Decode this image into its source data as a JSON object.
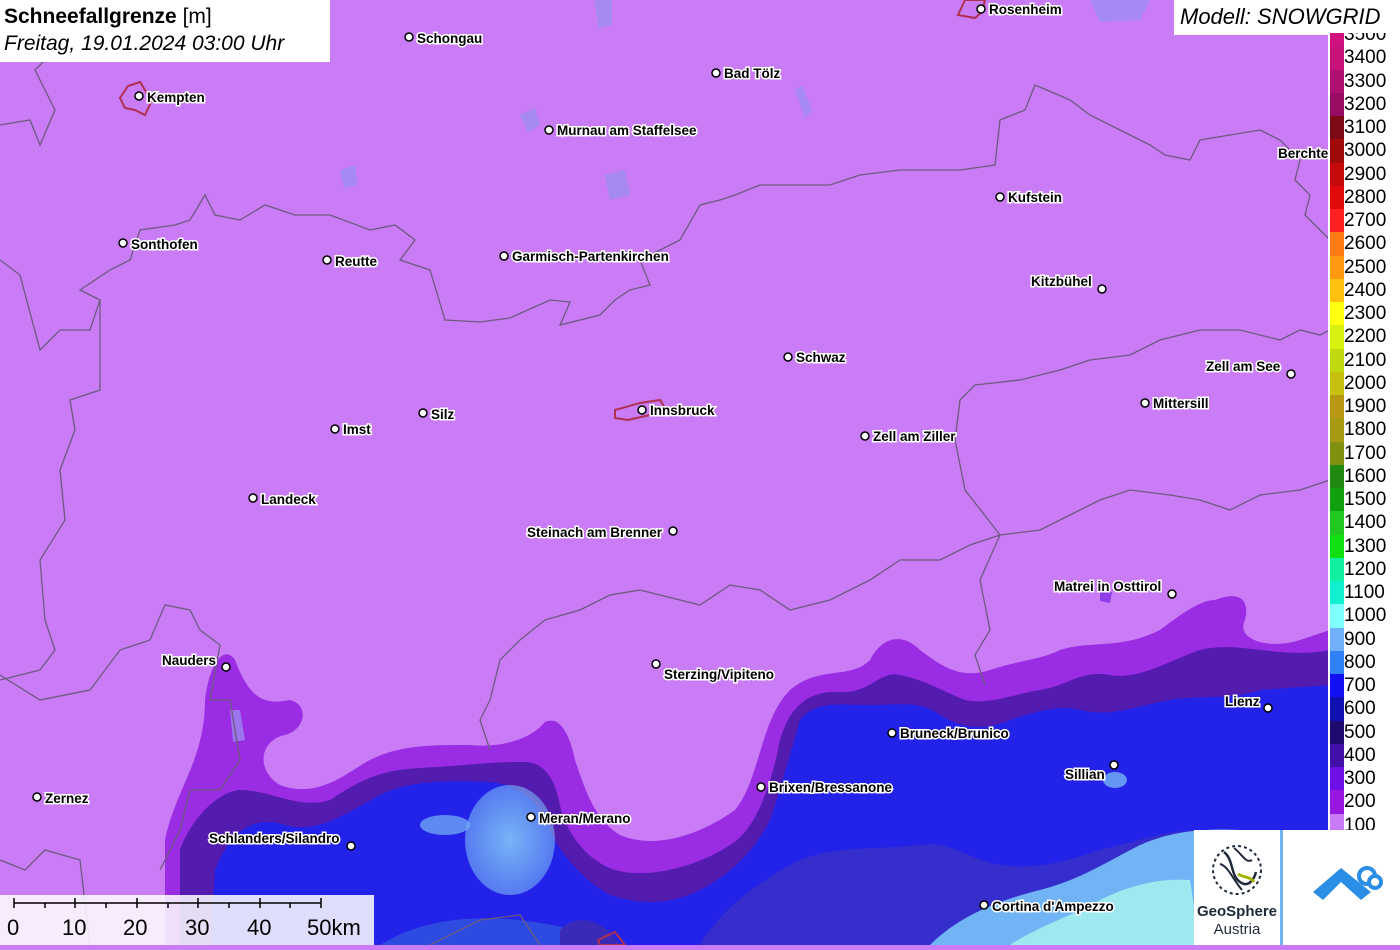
{
  "title": {
    "label": "Schneefallgrenze",
    "unit": "[m]",
    "datetime": "Freitag, 19.01.2024 03:00 Uhr"
  },
  "model": "Modell: SNOWGRID",
  "legend": {
    "items": [
      {
        "label": "3500",
        "color": "#d0117f"
      },
      {
        "label": "3400",
        "color": "#c8127a"
      },
      {
        "label": "3300",
        "color": "#b00f72"
      },
      {
        "label": "3200",
        "color": "#980c63"
      },
      {
        "label": "3100",
        "color": "#7e0a18"
      },
      {
        "label": "3000",
        "color": "#a00a0a"
      },
      {
        "label": "2900",
        "color": "#c40a0a"
      },
      {
        "label": "2800",
        "color": "#e00a0a"
      },
      {
        "label": "2700",
        "color": "#ff2020"
      },
      {
        "label": "2600",
        "color": "#ff7a10"
      },
      {
        "label": "2500",
        "color": "#ff9a10"
      },
      {
        "label": "2400",
        "color": "#ffc010"
      },
      {
        "label": "2300",
        "color": "#ffff10"
      },
      {
        "label": "2200",
        "color": "#d8f010"
      },
      {
        "label": "2100",
        "color": "#c0d810"
      },
      {
        "label": "2000",
        "color": "#c8c010"
      },
      {
        "label": "1900",
        "color": "#b89810"
      },
      {
        "label": "1800",
        "color": "#a89a10"
      },
      {
        "label": "1700",
        "color": "#809010"
      },
      {
        "label": "1600",
        "color": "#208a10"
      },
      {
        "label": "1500",
        "color": "#10a010"
      },
      {
        "label": "1400",
        "color": "#20c820"
      },
      {
        "label": "1300",
        "color": "#10e010"
      },
      {
        "label": "1200",
        "color": "#10f0a0"
      },
      {
        "label": "1100",
        "color": "#10f0d0"
      },
      {
        "label": "1000",
        "color": "#80ffff"
      },
      {
        "label": "900",
        "color": "#70b0f8"
      },
      {
        "label": "800",
        "color": "#3080f8"
      },
      {
        "label": "700",
        "color": "#1010f0"
      },
      {
        "label": "600",
        "color": "#1010b0"
      },
      {
        "label": "500",
        "color": "#200a70"
      },
      {
        "label": "400",
        "color": "#4010a8"
      },
      {
        "label": "300",
        "color": "#7010e8"
      },
      {
        "label": "200",
        "color": "#9818e0"
      },
      {
        "label": "100",
        "color": "#c87af6"
      }
    ]
  },
  "cities": [
    {
      "name": "Schongau"
    },
    {
      "name": "Rosenheim"
    },
    {
      "name": "Kempten"
    },
    {
      "name": "Bad Tölz"
    },
    {
      "name": "Murnau am Staffelsee"
    },
    {
      "name": "Berchte"
    },
    {
      "name": "Kufstein"
    },
    {
      "name": "Sonthofen"
    },
    {
      "name": "Reutte"
    },
    {
      "name": "Garmisch-Partenkirchen"
    },
    {
      "name": "Kitzbühel"
    },
    {
      "name": "Schwaz"
    },
    {
      "name": "Zell am See"
    },
    {
      "name": "Mittersill"
    },
    {
      "name": "Silz"
    },
    {
      "name": "Innsbruck"
    },
    {
      "name": "Imst"
    },
    {
      "name": "Zell am Ziller"
    },
    {
      "name": "Landeck"
    },
    {
      "name": "Steinach am Brenner"
    },
    {
      "name": "Matrei in Osttirol"
    },
    {
      "name": "Nauders"
    },
    {
      "name": "Sterzing/Vipiteno"
    },
    {
      "name": "Lienz"
    },
    {
      "name": "Bruneck/Brunico"
    },
    {
      "name": "Sillian"
    },
    {
      "name": "Brixen/Bressanone"
    },
    {
      "name": "Zernez"
    },
    {
      "name": "Meran/Merano"
    },
    {
      "name": "Schlanders/Silandro"
    },
    {
      "name": "Cortina d'Ampezzo"
    }
  ],
  "scale": {
    "ticks": [
      "0",
      "10",
      "20",
      "30",
      "40",
      "50km"
    ]
  },
  "logos": {
    "geosphere_line1": "GeoSphere",
    "geosphere_line2": "Austria"
  }
}
